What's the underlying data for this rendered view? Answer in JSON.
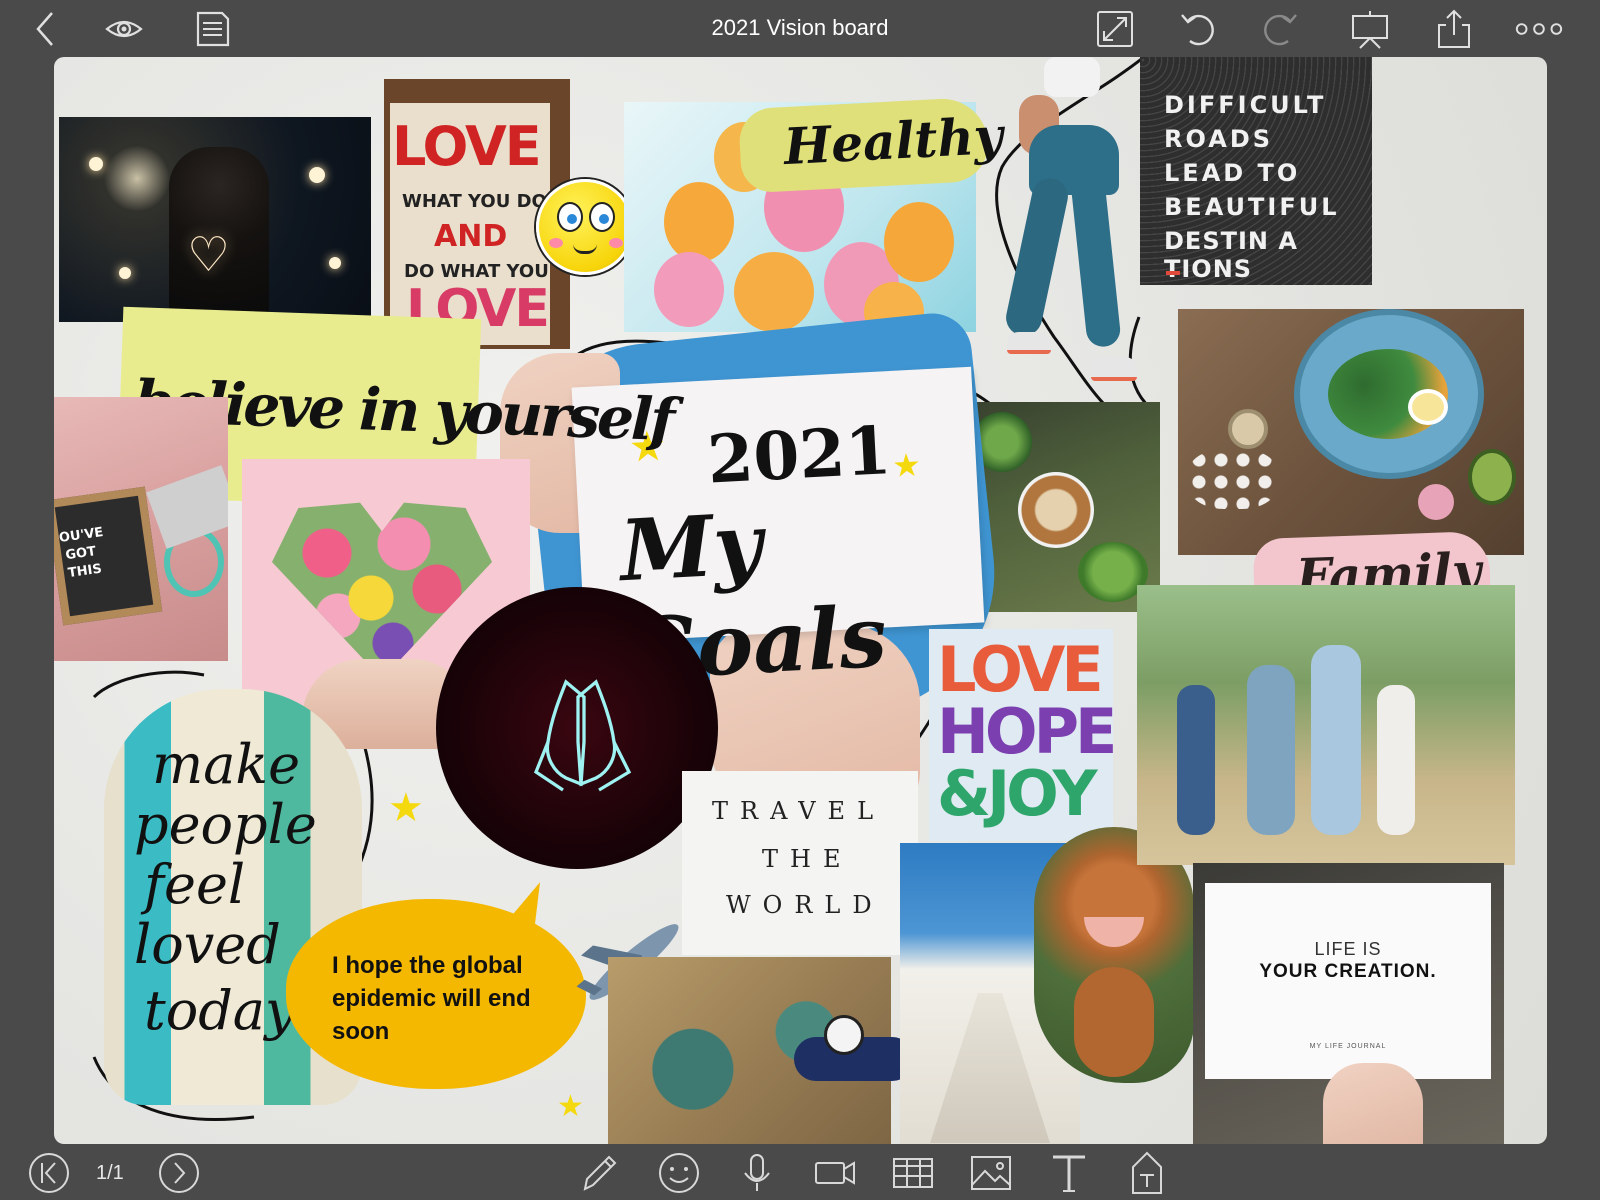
{
  "window": {
    "title": "2021 Vision board"
  },
  "toolbar": {
    "icons": [
      "back-icon",
      "eye-icon",
      "document-icon",
      "fullscreen-icon",
      "undo-icon",
      "redo-icon",
      "presentation-icon",
      "share-icon",
      "more-icon"
    ]
  },
  "board": {
    "goals_year": "2021",
    "goals_title": "My Goals",
    "believe": "believe in yourself",
    "love_sign": {
      "line1": "LOVE",
      "line2": "WHAT YOU DO",
      "line3": "AND",
      "line4": "DO WHAT YOU",
      "line5": "LOVE"
    },
    "healthy": "Healthy",
    "difficult_roads": [
      "DIFFICULT",
      "ROADS",
      "LEAD TO",
      "BEAUTIFUL",
      "DESTIN A TIONS"
    ],
    "youve_got_this": [
      "OU'VE",
      "GOT",
      "THIS"
    ],
    "family": "Family",
    "love_hope_joy": [
      "LOVE",
      "HOPE",
      "&JOY"
    ],
    "travel_tiles": [
      "TRAVEL",
      "THE",
      "WORLD"
    ],
    "make_people": [
      "make",
      "people",
      "feel",
      "loved",
      "today"
    ],
    "speech_bubble": "I hope the global epidemic will end soon",
    "life_card": {
      "line1": "LIFE IS",
      "line2": "YOUR CREATION.",
      "footer": "MY LIFE JOURNAL"
    }
  },
  "bottom": {
    "page": "1/1",
    "tools": [
      "previous-page-icon",
      "next-page-icon",
      "pen-icon",
      "sticker-icon",
      "microphone-icon",
      "video-icon",
      "table-icon",
      "image-icon",
      "text-icon",
      "textbox-icon"
    ]
  },
  "colors": {
    "chrome": "#4a4a4a",
    "accent_yellow": "#f5b800",
    "blue_accent": "#3b8fd1"
  }
}
